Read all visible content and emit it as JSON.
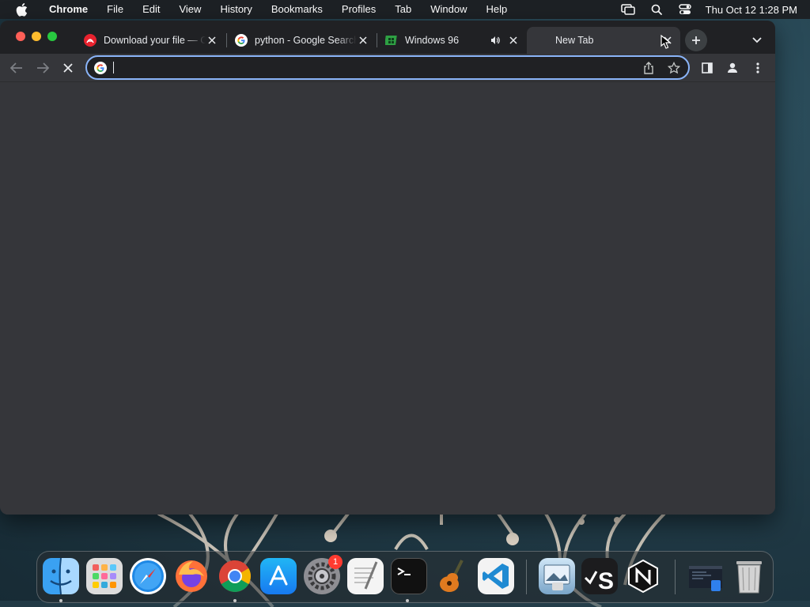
{
  "menubar": {
    "app_name": "Chrome",
    "items": [
      "File",
      "Edit",
      "View",
      "History",
      "Bookmarks",
      "Profiles",
      "Tab",
      "Window",
      "Help"
    ],
    "clock": "Thu Oct 12  1:28 PM"
  },
  "tabs": [
    {
      "title": "Download your file — C",
      "favicon": "adobe-acrobat-icon",
      "active": false
    },
    {
      "title": "python - Google Search",
      "favicon": "google-icon",
      "active": false
    },
    {
      "title": "Windows 96",
      "favicon": "windows96-icon",
      "active": false,
      "audio": true
    },
    {
      "title": "New Tab",
      "favicon": "",
      "active": true
    }
  ],
  "omnibox": {
    "value": "",
    "placeholder": ""
  },
  "dock": {
    "apps": [
      "Finder",
      "Launchpad",
      "Safari",
      "Firefox",
      "Google Chrome",
      "App Store",
      "System Settings",
      "TextEdit",
      "Terminal",
      "GarageBand",
      "Visual Studio Code",
      "Preview",
      "Script Editor",
      "Nova",
      "Screenshot",
      "Trash"
    ],
    "settings_badge": "1"
  },
  "colors": {
    "accent": "#8ab4f8",
    "window_bg": "#35363a",
    "tabstrip_bg": "#202124",
    "menubar_bg": "#1d2125"
  }
}
